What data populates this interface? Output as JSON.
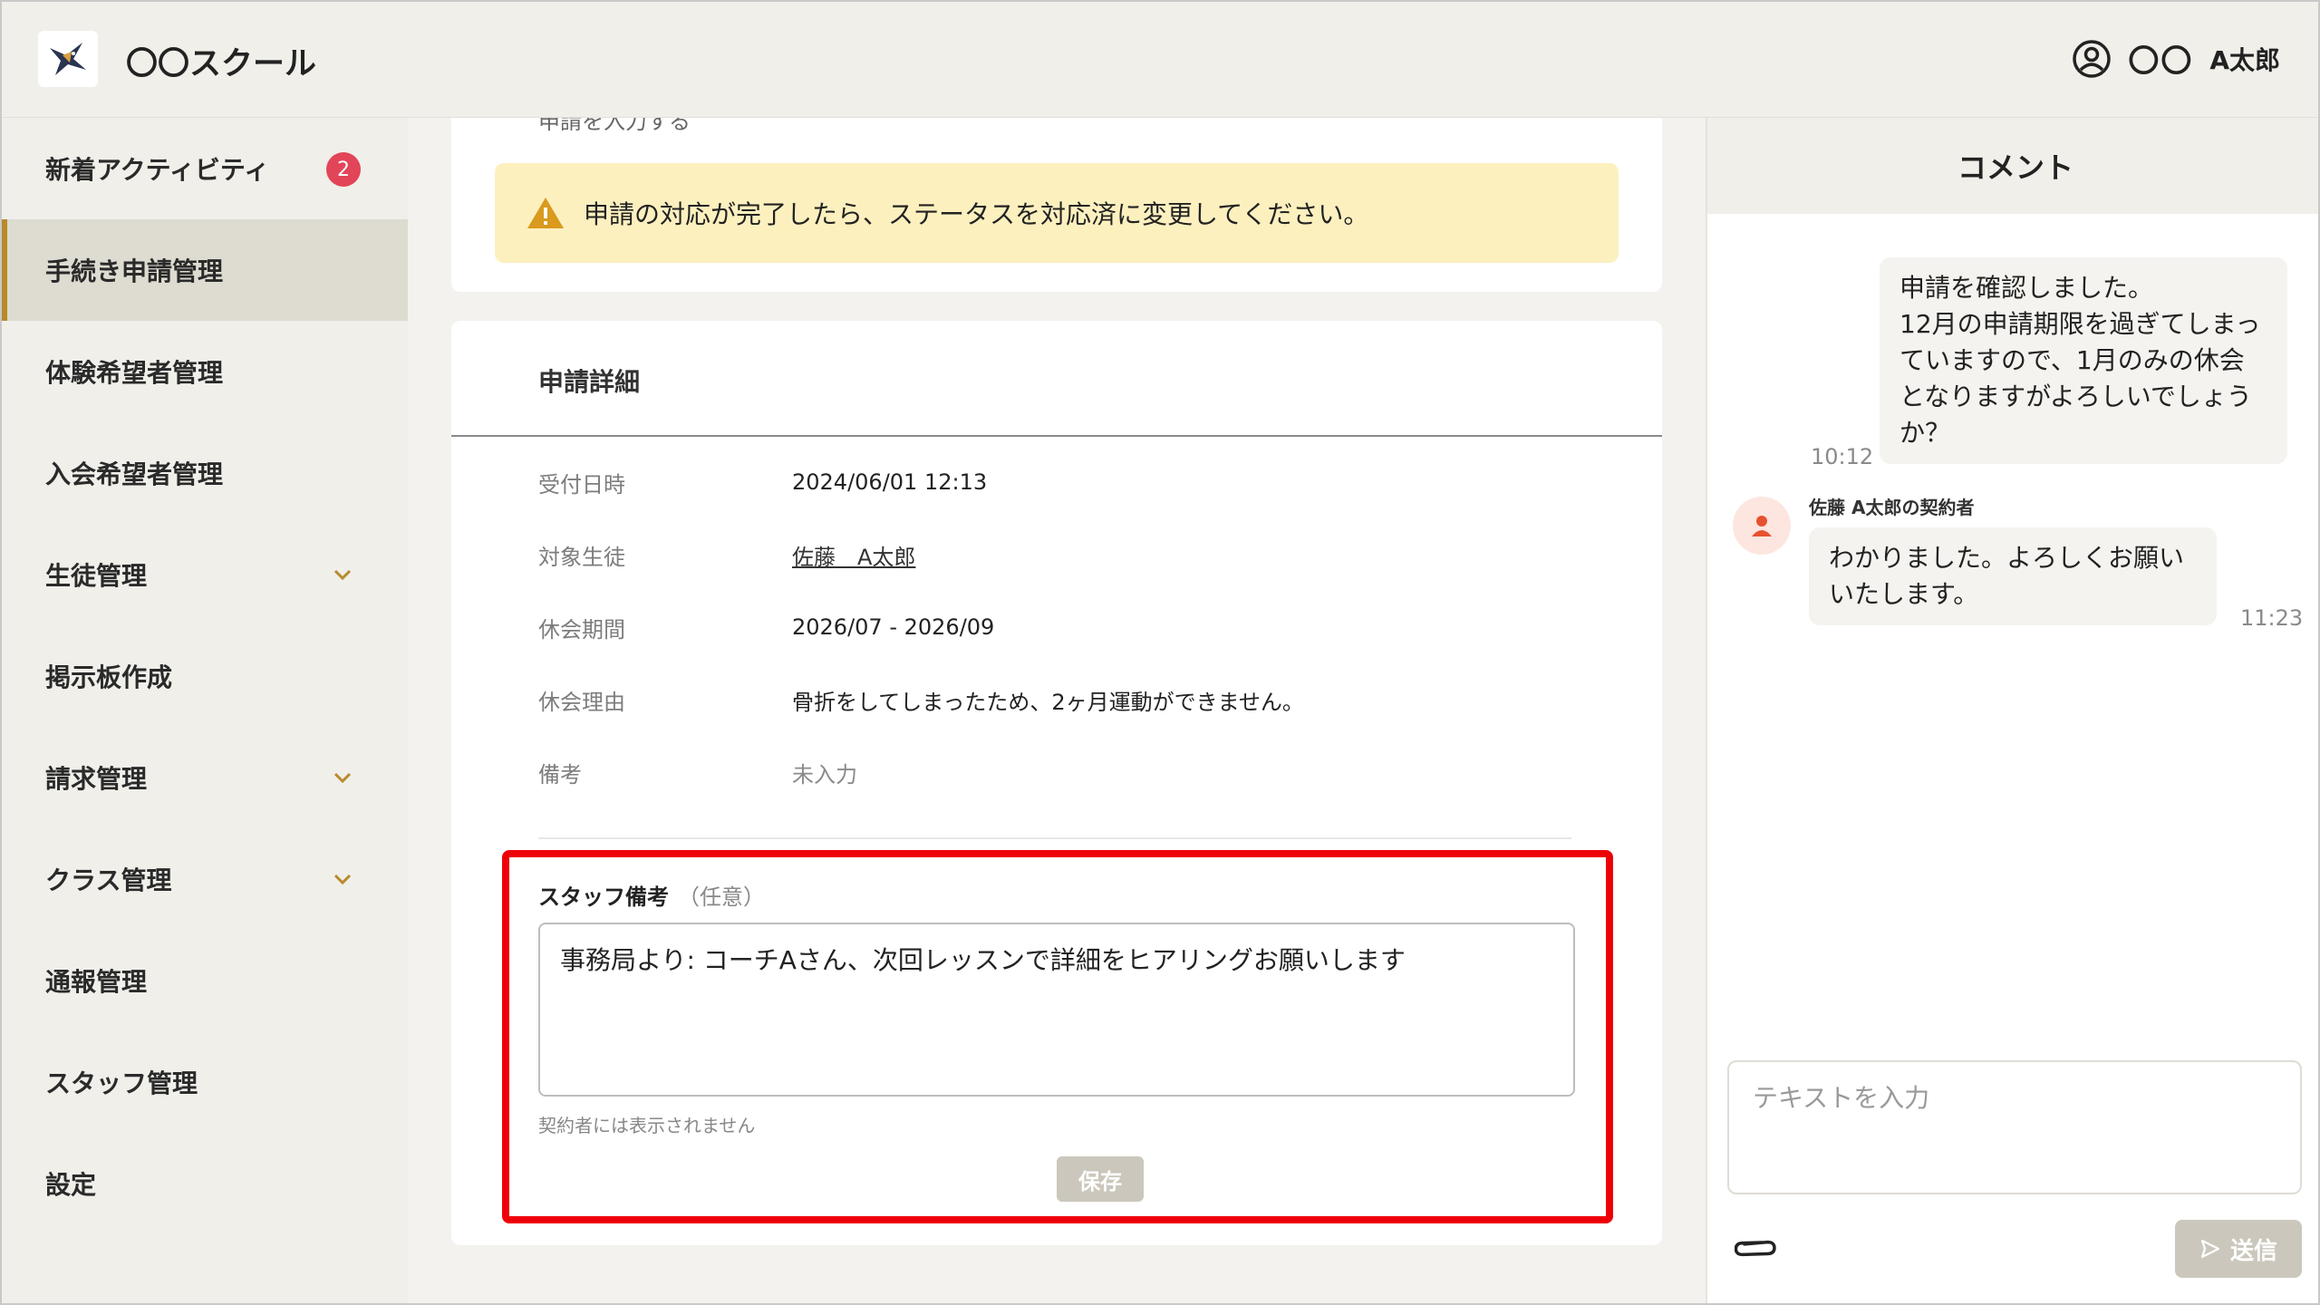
{
  "header": {
    "app_title": "〇〇スクール",
    "org": "〇〇",
    "user_name": "A太郎"
  },
  "sidebar": {
    "items": [
      {
        "label": "新着アクティビティ",
        "badge": "2"
      },
      {
        "label": "手続き申請管理",
        "active": true
      },
      {
        "label": "体験希望者管理"
      },
      {
        "label": "入会希望者管理"
      },
      {
        "label": "生徒管理",
        "expandable": true
      },
      {
        "label": "掲示板作成"
      },
      {
        "label": "請求管理",
        "expandable": true
      },
      {
        "label": "クラス管理",
        "expandable": true
      },
      {
        "label": "通報管理"
      },
      {
        "label": "スタッフ管理"
      },
      {
        "label": "設定"
      }
    ]
  },
  "main": {
    "partial_top_text": "申請を入力する",
    "warning_text": "申請の対応が完了したら、ステータスを対応済に変更してください。",
    "detail": {
      "title": "申請詳細",
      "rows": [
        {
          "label": "受付日時",
          "value": "2024/06/01 12:13"
        },
        {
          "label": "対象生徒",
          "value": "佐藤　A太郎"
        },
        {
          "label": "休会期間",
          "value": "2026/07 - 2026/09"
        },
        {
          "label": "休会理由",
          "value": "骨折をしてしまったため、2ヶ月運動ができません。"
        },
        {
          "label": "備考",
          "value": "未入力"
        }
      ]
    },
    "staff_note": {
      "label": "スタッフ備考",
      "optional": "（任意）",
      "value": "事務局より: コーチAさん、次回レッスンで詳細をヒアリングお願いします",
      "helper": "契約者には表示されません",
      "save_label": "保存"
    }
  },
  "comments": {
    "title": "コメント",
    "messages": [
      {
        "from": "me",
        "text": "申請を確認しました。\n12月の申請期限を過ぎてしまっていますので、1月のみの休会となりますがよろしいでしょうか？",
        "time": "10:12"
      },
      {
        "from": "other",
        "sender": "佐藤 A太郎の契約者",
        "text": "わかりました。よろしくお願いいたします。",
        "time": "11:23"
      }
    ],
    "input_placeholder": "テキストを入力",
    "send_label": "送信"
  },
  "colors": {
    "accent": "#b98a2c",
    "badge": "#e24458",
    "highlight": "#ee0008",
    "warning_bg": "#fdf0bf"
  }
}
